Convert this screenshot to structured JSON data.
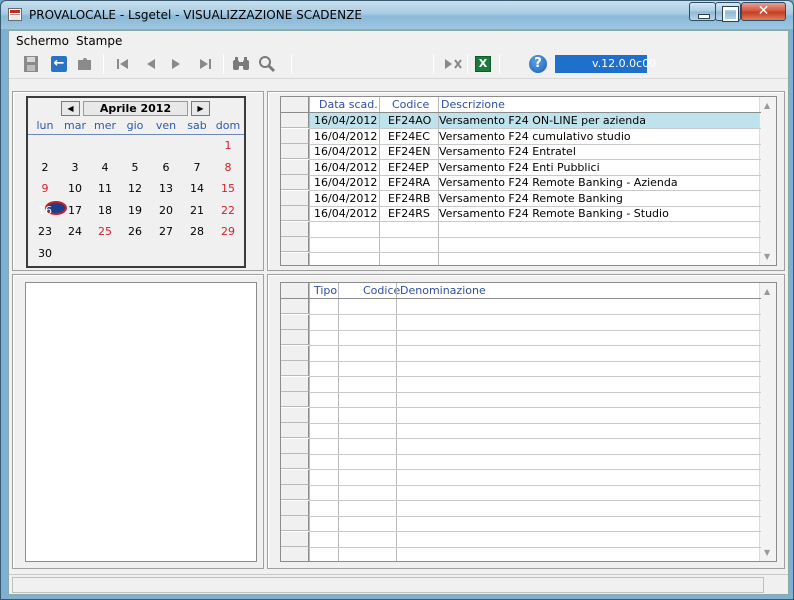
{
  "window": {
    "title": "PROVALOCALE - Lsgetel - VISUALIZZAZIONE SCADENZE"
  },
  "menu": {
    "items": [
      "Schermo",
      "Stampe"
    ]
  },
  "toolbar": {
    "icons": [
      "save-icon",
      "back-icon",
      "puzzle-icon",
      "first-record-icon",
      "prev-record-icon",
      "next-record-icon",
      "last-record-icon",
      "binoculars-icon",
      "search-icon",
      "delete-icon",
      "excel-icon",
      "help-icon"
    ],
    "version": "v.12.0.0c00"
  },
  "calendar": {
    "month_title": "Aprile 2012",
    "weekdays": [
      "lun",
      "mar",
      "mer",
      "gio",
      "ven",
      "sab",
      "dom"
    ],
    "weeks": [
      [
        "",
        "",
        "",
        "",
        "",
        "",
        "1"
      ],
      [
        "2",
        "3",
        "4",
        "5",
        "6",
        "7",
        "8"
      ],
      [
        "9",
        "10",
        "11",
        "12",
        "13",
        "14",
        "15"
      ],
      [
        "16",
        "17",
        "18",
        "19",
        "20",
        "21",
        "22"
      ],
      [
        "23",
        "24",
        "25",
        "26",
        "27",
        "28",
        "29"
      ],
      [
        "30",
        "",
        "",
        "",
        "",
        "",
        ""
      ]
    ],
    "today": "16",
    "holiday_color": "#d8202a"
  },
  "deadlines": {
    "columns": [
      "Data scad.",
      "Codice",
      "Descrizione"
    ],
    "rows": [
      {
        "date": "16/04/2012",
        "code": "EF24AO",
        "description": "Versamento F24 ON-LINE per azienda"
      },
      {
        "date": "16/04/2012",
        "code": "EF24EC",
        "description": "Versamento F24 cumulativo studio"
      },
      {
        "date": "16/04/2012",
        "code": "EF24EN",
        "description": "Versamento F24 Entratel"
      },
      {
        "date": "16/04/2012",
        "code": "EF24EP",
        "description": "Versamento F24 Enti Pubblici"
      },
      {
        "date": "16/04/2012",
        "code": "EF24RA",
        "description": "Versamento F24 Remote Banking - Azienda"
      },
      {
        "date": "16/04/2012",
        "code": "EF24RB",
        "description": "Versamento F24 Remote Banking"
      },
      {
        "date": "16/04/2012",
        "code": "EF24RS",
        "description": "Versamento F24 Remote Banking - Studio"
      }
    ]
  },
  "details": {
    "columns": [
      "Tipo",
      "Codice",
      "Denominazione"
    ]
  }
}
